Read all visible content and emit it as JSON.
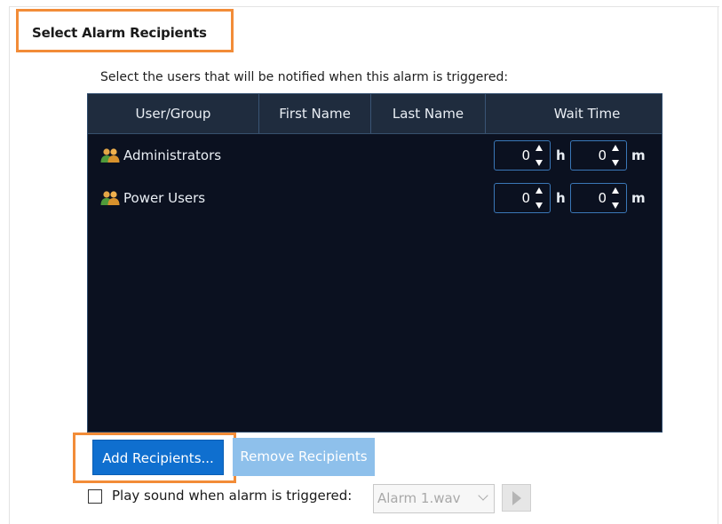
{
  "section": {
    "title": "Select Alarm Recipients",
    "instructions": "Select the users that will be notified when this alarm is triggered:"
  },
  "table": {
    "columns": [
      "User/Group",
      "First Name",
      "Last Name",
      "Wait Time"
    ],
    "rows": [
      {
        "name": "Administrators",
        "icon": "user-group-icon",
        "first_name": "",
        "last_name": "",
        "hours": "0",
        "minutes": "0"
      },
      {
        "name": "Power Users",
        "icon": "user-group-icon",
        "first_name": "",
        "last_name": "",
        "hours": "0",
        "minutes": "0"
      }
    ],
    "units": {
      "hours": "h",
      "minutes": "m"
    }
  },
  "buttons": {
    "add": "Add Recipients...",
    "remove": "Remove Recipients"
  },
  "sound": {
    "label": "Play sound when alarm is triggered:",
    "checked": false,
    "file": "Alarm 1.wav"
  },
  "colors": {
    "highlight": "#f28c38",
    "primary_button": "#0f6fcf",
    "disabled_button": "#8ec0eb",
    "table_bg": "#0b1120",
    "table_header": "#1f2c3e"
  }
}
